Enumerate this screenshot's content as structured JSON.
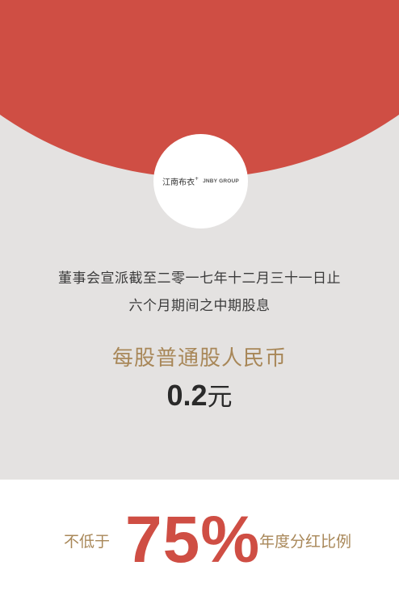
{
  "logo": {
    "cn_name": "江南布衣",
    "cn_mark": "+",
    "en_name": "JNBY GROUP"
  },
  "announcement": {
    "line1": "董事会宣派截至二零一七年十二月三十一日止",
    "line2": "六个月期间之中期股息"
  },
  "dividend": {
    "label": "每股普通股人民币",
    "amount": "0.2",
    "unit": "元"
  },
  "payout": {
    "prefix": "不低于",
    "value": "75%",
    "suffix": "年度分红比例"
  },
  "colors": {
    "accent_red": "#cf4e44",
    "accent_gold": "#a88758",
    "panel_grey": "#e4e2e1"
  }
}
